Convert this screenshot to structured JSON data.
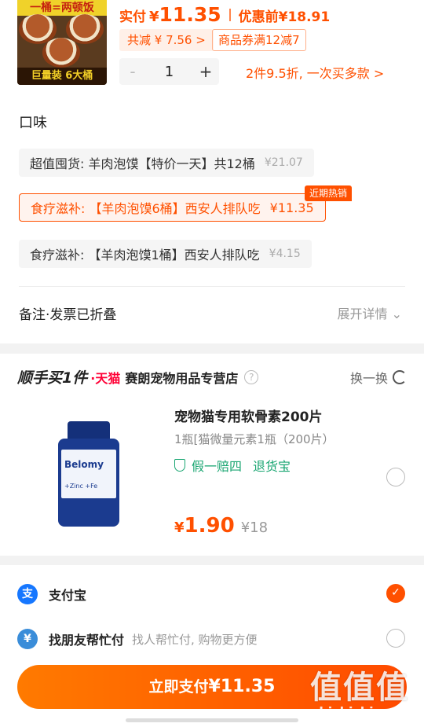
{
  "product": {
    "thumb_top_text": "一桶=两顿饭",
    "thumb_bottom_text": "巨量装 6大桶",
    "pay_label": "实付",
    "currency": "¥",
    "pay_amount": "11.35",
    "orig_label": "优惠前",
    "orig_price": "¥18.91",
    "save_tag": "共减 ¥ 7.56 >",
    "coupon_tag": "商品券满12减7",
    "quantity": "1",
    "minus_label": "-",
    "plus_label": "+",
    "deal_link": "2件9.5折, 一次买多款 >"
  },
  "flavor": {
    "section_title": "口味",
    "hot_badge": "近期热销",
    "options": [
      {
        "label": "超值囤货: 羊肉泡馍【特价一天】共12桶",
        "price": "¥21.07",
        "selected": false
      },
      {
        "label": "食疗滋补: 【羊肉泡馍6桶】西安人排队吃",
        "price": "¥11.35",
        "selected": true
      },
      {
        "label": "食疗滋补: 【羊肉泡馍1桶】西安人排队吃",
        "price": "¥4.15",
        "selected": false
      }
    ]
  },
  "remark": {
    "label": "备注·发票已折叠",
    "expand_label": "展开详情 ⌄"
  },
  "addon": {
    "brand": "顺手买1件",
    "tmall": "·天猫",
    "store_name": "赛朗宠物用品专营店",
    "help_icon": "?",
    "swap_label": "换一换",
    "bottle_brand": "Belomy",
    "bottle_sub": "+Zinc +Fe",
    "title": "宠物猫专用软骨素200片",
    "spec": "1瓶[猫微量元素1瓶（200片）",
    "guarantee_1": "假一赔四",
    "guarantee_2": "退货宝",
    "price_yen": "¥",
    "price": "1.90",
    "was_price": "¥18"
  },
  "payment": {
    "methods": [
      {
        "icon": "支",
        "name": "支付宝",
        "sub": "",
        "selected": true
      },
      {
        "icon": "¥",
        "name": "找朋友帮忙付",
        "sub": "找人帮忙付, 购物更方便",
        "selected": false
      }
    ],
    "button_label": "立即支付",
    "button_amount": "¥11.35"
  },
  "watermark": {
    "big": "值值值",
    "small": "zhizhizhi.com"
  },
  "colors": {
    "accent": "#ff5000",
    "green": "#1aa672",
    "alipay_blue": "#1677ff"
  }
}
